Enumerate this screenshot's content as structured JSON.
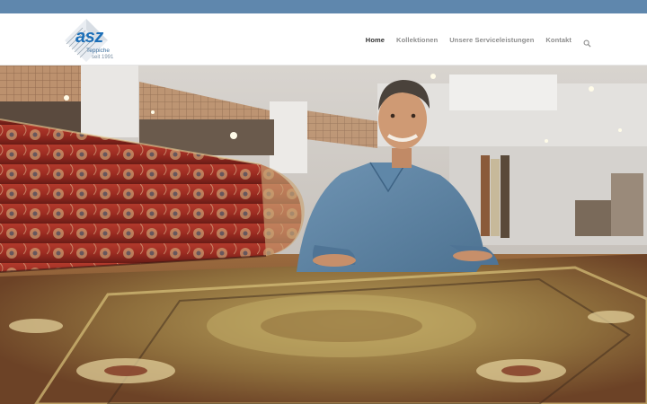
{
  "brand": {
    "logo_text": "asz",
    "logo_subtitle": "Teppiche",
    "logo_since": "seit 1991",
    "accent_color": "#1c6fb8",
    "topbar_color": "#5f87ad"
  },
  "nav": {
    "items": [
      {
        "label": "Home",
        "active": true
      },
      {
        "label": "Kollektionen",
        "active": false
      },
      {
        "label": "Unsere Serviceleistungen",
        "active": false
      },
      {
        "label": "Kontakt",
        "active": false
      }
    ],
    "search_icon": "search-icon"
  },
  "hero": {
    "image_icon": "showroom-photo"
  }
}
